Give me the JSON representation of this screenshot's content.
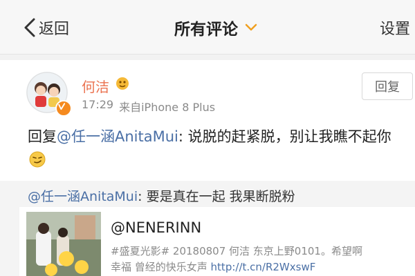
{
  "nav": {
    "back_label": "返回",
    "title": "所有评论",
    "settings_label": "设置"
  },
  "comment": {
    "author": "何洁",
    "time": "17:29",
    "source": "来自iPhone 8 Plus",
    "reply_button": "回复",
    "text_prefix": "回复",
    "mention": "@任一涵AnitaMui",
    "text": ": 说脱的赶紧脱，别让我瞧不起你",
    "emoji": "smirk-emoji"
  },
  "quoted": {
    "mention": "@任一涵AnitaMui",
    "text": ": 要是真在一起 我果断脱粉"
  },
  "card": {
    "title": "@NENERINN",
    "desc_line1": "#盛夏光影# 20180807  何洁 东京上野0101。希望啊",
    "desc_line2": "幸福 曾经的快乐女声 ",
    "link": "http://t.cn/R2WxswF"
  },
  "colors": {
    "accent_name": "#eb7350",
    "mention": "#4a6fa5",
    "badge": "#f58a1f"
  },
  "icons": {
    "back": "chevron-left-icon",
    "dropdown": "chevron-down-icon",
    "verified": "verified-badge-icon",
    "medal": "medal-icon"
  }
}
